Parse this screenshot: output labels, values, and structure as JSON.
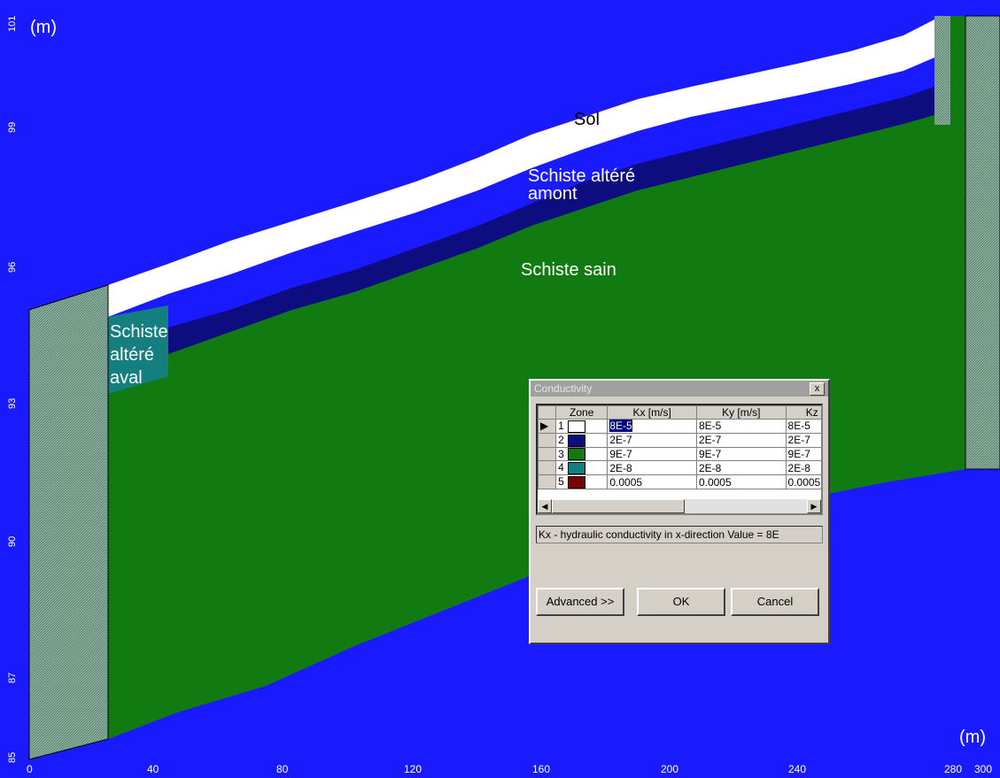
{
  "axes": {
    "y_unit": "(m)",
    "x_unit": "(m)",
    "y_ticks": [
      "101",
      "99",
      "96",
      "93",
      "90",
      "87",
      "85"
    ],
    "x_ticks": [
      "0",
      "40",
      "80",
      "120",
      "160",
      "200",
      "240",
      "280",
      "300"
    ]
  },
  "zones": {
    "sol": "Sol",
    "amont_line1": "Schiste altéré",
    "amont_line2": "amont",
    "sain": "Schiste sain",
    "aval_line1": "Schiste",
    "aval_line2": "altéré",
    "aval_line3": "aval"
  },
  "colors": {
    "background": "#1a1aff",
    "sol": "#ffffff",
    "amont": "#0d0d80",
    "sain": "#117a11",
    "aval": "#157f80",
    "boundary": "#5a7f70"
  },
  "dialog": {
    "title": "Conductivity",
    "close": "x",
    "headers": [
      "Zone",
      "Kx [m/s]",
      "Ky [m/s]",
      "Kz [m/"
    ],
    "rows": [
      {
        "zone": "1",
        "color": "#ffffff",
        "kx": "8E-5",
        "ky": "8E-5",
        "kz": "8E-5"
      },
      {
        "zone": "2",
        "color": "#0d0d80",
        "kx": "2E-7",
        "ky": "2E-7",
        "kz": "2E-7"
      },
      {
        "zone": "3",
        "color": "#117a11",
        "kx": "9E-7",
        "ky": "9E-7",
        "kz": "9E-7"
      },
      {
        "zone": "4",
        "color": "#157f80",
        "kx": "2E-8",
        "ky": "2E-8",
        "kz": "2E-8"
      },
      {
        "zone": "5",
        "color": "#7a0000",
        "kx": "0.0005",
        "ky": "0.0005",
        "kz": "0.0005"
      }
    ],
    "status": "Kx - hydraulic conductivity in x-direction Value = 8E",
    "advanced": "Advanced >>",
    "ok": "OK",
    "cancel": "Cancel"
  }
}
